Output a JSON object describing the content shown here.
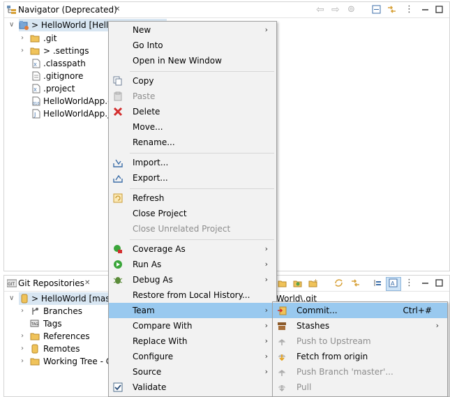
{
  "navigator": {
    "title": "Navigator (Deprecated)",
    "project_label": "> HelloWorld [Hello",
    "items": [
      ".git",
      "> .settings",
      ".classpath",
      ".gitignore",
      ".project",
      "HelloWorldApp.c",
      "HelloWorldApp.ja"
    ]
  },
  "git_repos": {
    "title": "Git Repositories",
    "repo_label": "> HelloWorld [mast",
    "children": [
      "Branches",
      "Tags",
      "References",
      "Remotes",
      "Working Tree - C"
    ],
    "path_fragment": "World\\.git"
  },
  "context_menu": {
    "items": [
      {
        "label": "New",
        "submenu": true,
        "enabled": true,
        "icon": ""
      },
      {
        "label": "Go Into",
        "submenu": false,
        "enabled": true,
        "icon": ""
      },
      {
        "label": "Open in New Window",
        "submenu": false,
        "enabled": true,
        "icon": ""
      },
      {
        "label": "Copy",
        "submenu": false,
        "enabled": true,
        "icon": "copy-icon"
      },
      {
        "label": "Paste",
        "submenu": false,
        "enabled": false,
        "icon": "paste-icon"
      },
      {
        "label": "Delete",
        "submenu": false,
        "enabled": true,
        "icon": "delete-icon"
      },
      {
        "label": "Move...",
        "submenu": false,
        "enabled": true,
        "icon": ""
      },
      {
        "label": "Rename...",
        "submenu": false,
        "enabled": true,
        "icon": ""
      },
      {
        "label": "Import...",
        "submenu": false,
        "enabled": true,
        "icon": "import-icon"
      },
      {
        "label": "Export...",
        "submenu": false,
        "enabled": true,
        "icon": "export-icon"
      },
      {
        "label": "Refresh",
        "submenu": false,
        "enabled": true,
        "icon": "refresh-icon"
      },
      {
        "label": "Close Project",
        "submenu": false,
        "enabled": true,
        "icon": ""
      },
      {
        "label": "Close Unrelated Project",
        "submenu": false,
        "enabled": false,
        "icon": ""
      },
      {
        "label": "Coverage As",
        "submenu": true,
        "enabled": true,
        "icon": "coverage-icon"
      },
      {
        "label": "Run As",
        "submenu": true,
        "enabled": true,
        "icon": "run-icon"
      },
      {
        "label": "Debug As",
        "submenu": true,
        "enabled": true,
        "icon": "debug-icon"
      },
      {
        "label": "Restore from Local History...",
        "submenu": false,
        "enabled": true,
        "icon": ""
      },
      {
        "label": "Team",
        "submenu": true,
        "enabled": true,
        "icon": "",
        "selected": true
      },
      {
        "label": "Compare With",
        "submenu": true,
        "enabled": true,
        "icon": ""
      },
      {
        "label": "Replace With",
        "submenu": true,
        "enabled": true,
        "icon": ""
      },
      {
        "label": "Configure",
        "submenu": true,
        "enabled": true,
        "icon": ""
      },
      {
        "label": "Source",
        "submenu": true,
        "enabled": true,
        "icon": ""
      },
      {
        "label": "Validate",
        "submenu": false,
        "enabled": true,
        "icon": "checkbox-checked-icon"
      }
    ]
  },
  "team_submenu": {
    "items": [
      {
        "label": "Commit...",
        "accel": "Ctrl+#",
        "enabled": true,
        "submenu": false,
        "selected": true,
        "icon": "commit-icon"
      },
      {
        "label": "Stashes",
        "accel": "",
        "enabled": true,
        "submenu": true,
        "icon": "stash-icon"
      },
      {
        "label": "Push to Upstream",
        "accel": "",
        "enabled": false,
        "submenu": false,
        "icon": "push-icon"
      },
      {
        "label": "Fetch from origin",
        "accel": "",
        "enabled": true,
        "submenu": false,
        "icon": "fetch-icon"
      },
      {
        "label": "Push Branch 'master'...",
        "accel": "",
        "enabled": false,
        "submenu": false,
        "icon": "push-branch-icon"
      },
      {
        "label": "Pull",
        "accel": "",
        "enabled": false,
        "submenu": false,
        "icon": "pull-icon"
      }
    ]
  },
  "colors": {
    "selection": "#99c9ef",
    "menu_bg": "#f2f2f2",
    "disabled_text": "#8d8d8d"
  }
}
